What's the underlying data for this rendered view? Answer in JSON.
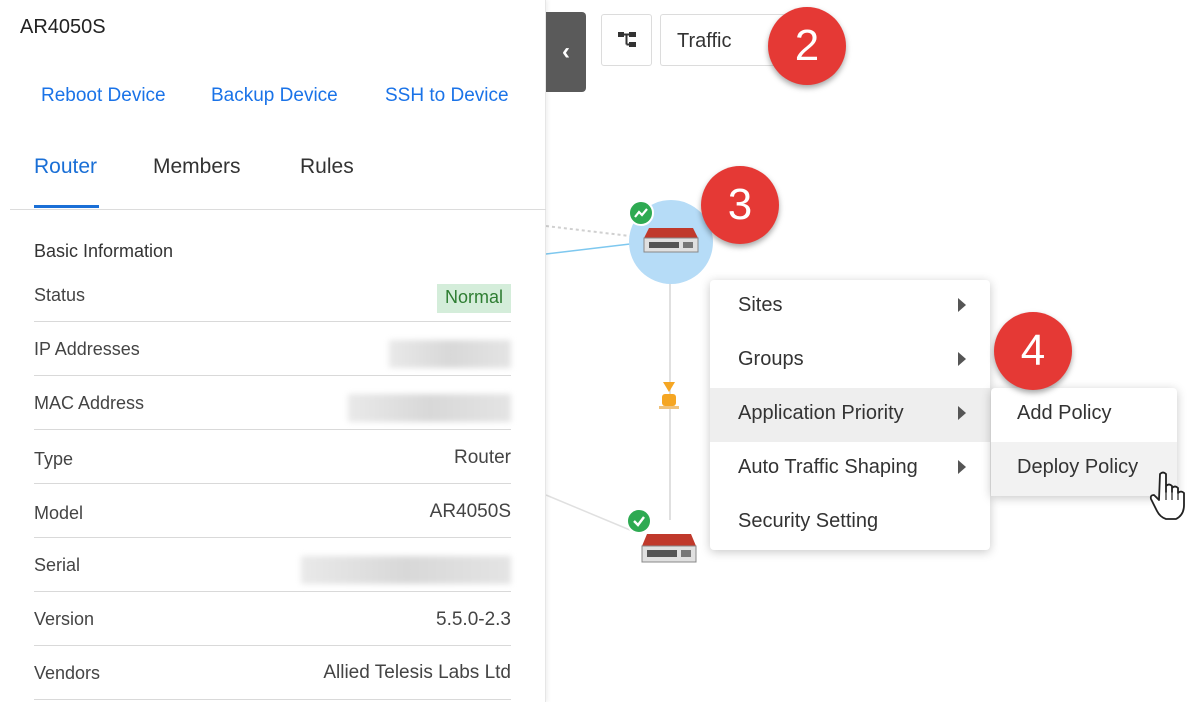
{
  "device": {
    "name": "AR4050S",
    "actions": [
      "Reboot Device",
      "Backup Device",
      "SSH to Device"
    ]
  },
  "tabs": [
    {
      "label": "Router",
      "active": true
    },
    {
      "label": "Members",
      "active": false
    },
    {
      "label": "Rules",
      "active": false
    }
  ],
  "basic_info": {
    "title": "Basic Information",
    "rows": [
      {
        "label": "Status",
        "value": "Normal",
        "kind": "badge"
      },
      {
        "label": "IP Addresses",
        "value": "",
        "kind": "redacted"
      },
      {
        "label": "MAC Address",
        "value": "",
        "kind": "redacted"
      },
      {
        "label": "Type",
        "value": "Router",
        "kind": "text"
      },
      {
        "label": "Model",
        "value": "AR4050S",
        "kind": "text"
      },
      {
        "label": "Serial",
        "value": "",
        "kind": "redacted"
      },
      {
        "label": "Version",
        "value": "5.5.0-2.3",
        "kind": "text"
      },
      {
        "label": "Vendors",
        "value": "Allied Telesis Labs Ltd",
        "kind": "text"
      }
    ]
  },
  "toolbar": {
    "collapse_icon": "chevron-left-icon",
    "topology_icon": "topology-icon",
    "view_select": "Traffic"
  },
  "markers": [
    "2",
    "3",
    "4"
  ],
  "context_menu": {
    "items": [
      {
        "label": "Sites",
        "has_submenu": true
      },
      {
        "label": "Groups",
        "has_submenu": true
      },
      {
        "label": "Application Priority",
        "has_submenu": true
      },
      {
        "label": "Auto Traffic Shaping",
        "has_submenu": true
      },
      {
        "label": "Security Setting",
        "has_submenu": false
      }
    ],
    "submenu": [
      "Add Policy",
      "Deploy Policy"
    ]
  },
  "colors": {
    "link": "#1a73e8",
    "marker": "#e53935",
    "status_ok": "#2eaa52",
    "badge_bg": "#d4edda",
    "halo": "#b6dcf7"
  }
}
